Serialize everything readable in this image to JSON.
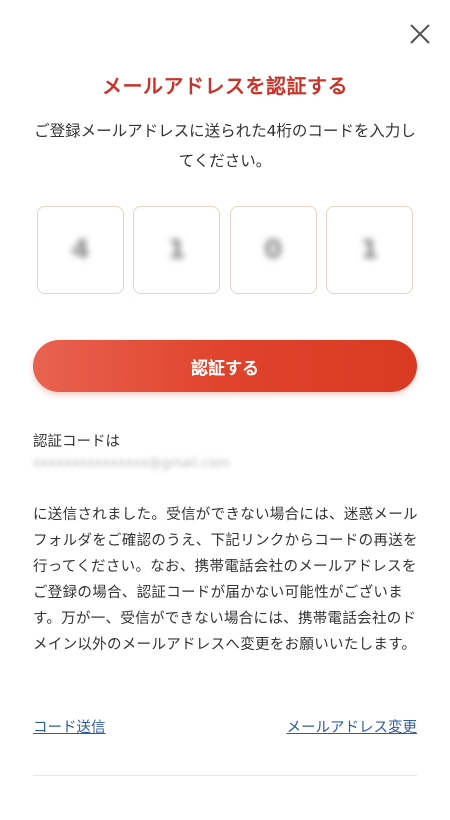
{
  "dialog": {
    "title": "メールアドレスを認証する",
    "description": "ご登録メールアドレスに送られた4桁のコードを入力してください。"
  },
  "code_inputs": [
    {
      "value": "4"
    },
    {
      "value": "1"
    },
    {
      "value": "0"
    },
    {
      "value": "1"
    }
  ],
  "verify_button": {
    "label": "認証する"
  },
  "info": {
    "code_label": "認証コードは",
    "email_masked": "xxxxxxxxxxxxxxx@gmail.com",
    "notice": "に送信されました。受信ができない場合には、迷惑メールフォルダをご確認のうえ、下記リンクからコードの再送を行ってください。なお、携帯電話会社のメールアドレスをご登録の場合、認証コードが届かない可能性がございます。万が一、受信ができない場合には、携帯電話会社のドメイン以外のメールアドレスへ変更をお願いいたします。"
  },
  "links": {
    "resend": "コード送信",
    "change_email": "メールアドレス変更"
  },
  "colors": {
    "accent": "#c8342a",
    "button": "#e0432c",
    "link": "#2f5d9c"
  }
}
